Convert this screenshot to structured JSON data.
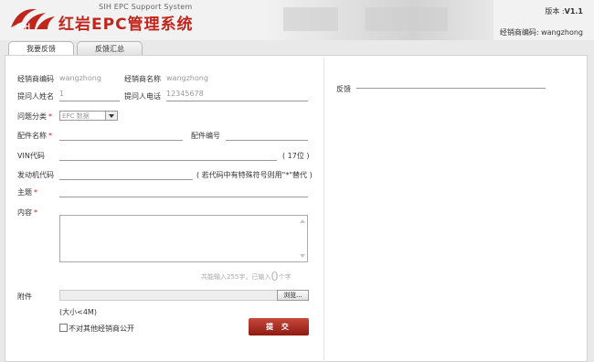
{
  "header": {
    "brand_en": "SIH EPC Support System",
    "brand_cn": "红岩EPC管理系统",
    "logo_text": "SIH",
    "version_label": "版本 :",
    "version_value": "V1.1",
    "dealer_code_line": "经销商编码: wangzhong"
  },
  "tabs": [
    {
      "label": "我要反馈",
      "active": true
    },
    {
      "label": "反馈汇总",
      "active": false
    }
  ],
  "form": {
    "dealer_code_label": "经销商编码",
    "dealer_code_value": "wangzhong",
    "dealer_name_label": "经销商名称",
    "dealer_name_value": "wangzhong",
    "asker_name_label": "提问人姓名",
    "asker_name_value": "1",
    "asker_phone_label": "提问人电话",
    "asker_phone_value": "12345678",
    "category_label": "问题分类",
    "category_value": "EPC 数据",
    "part_name_label": "配件名称",
    "part_no_label": "配件编号",
    "vin_label": "VIN代码",
    "vin_hint": "( 17位 )",
    "engine_label": "发动机代码",
    "engine_hint": "( 若代码中有特殊符号则用\"*\"替代 )",
    "subject_label": "主题",
    "content_label": "内容",
    "count_prefix": "共能输入255字，已输入",
    "count_value": "0",
    "count_suffix": "个字",
    "attachment_label": "附件",
    "browse_label": "浏览...",
    "size_note": "(大小<4M)",
    "private_label": "不对其他经销商公开",
    "submit_label": "提 交",
    "required_mark": "*"
  },
  "feedback": {
    "title": "反馈"
  },
  "colors": {
    "brand_red": "#c0261c",
    "submit_top": "#c7473b",
    "submit_bottom": "#8e1a12"
  }
}
